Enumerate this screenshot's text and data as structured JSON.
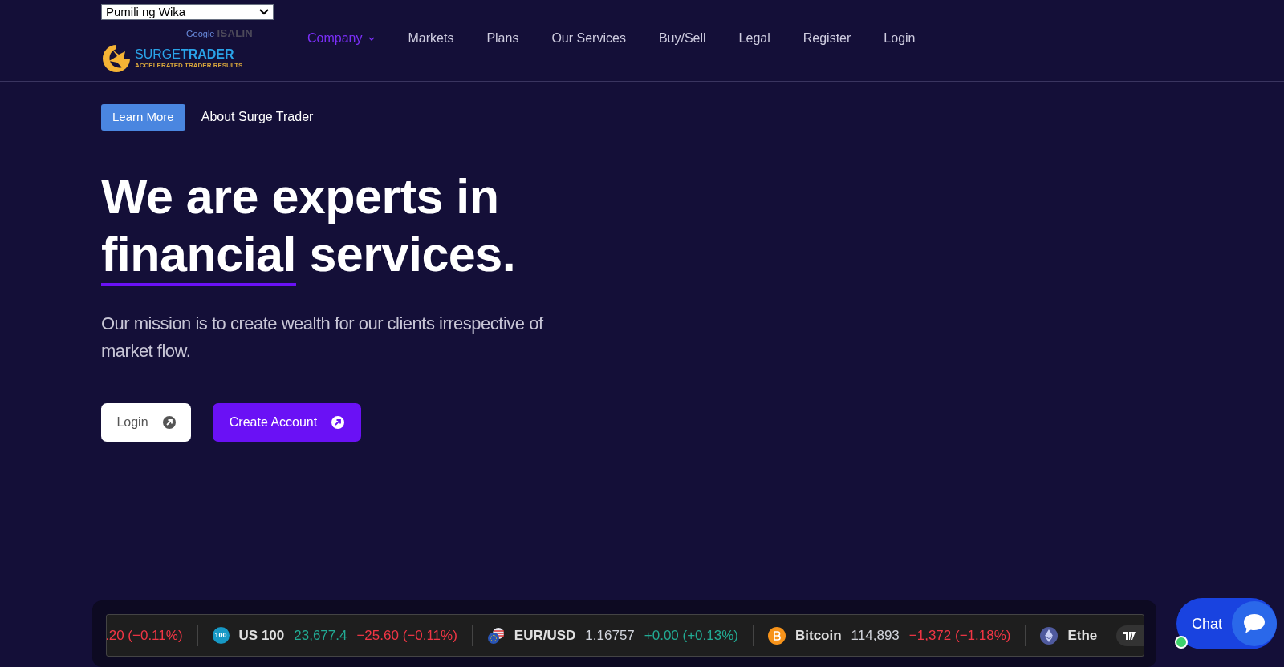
{
  "language_select": {
    "value": "Pumili ng Wika"
  },
  "translate_credit": {
    "brand": "Google",
    "action": "ISALIN"
  },
  "logo": {
    "name_part1": "SURGE",
    "name_part2": "TRADER",
    "tagline": "ACCELERATED TRADER RESULTS"
  },
  "nav": [
    {
      "label": "Company",
      "selected": true,
      "has_menu": true
    },
    {
      "label": "Markets",
      "selected": false,
      "has_menu": false
    },
    {
      "label": "Plans",
      "selected": false,
      "has_menu": false
    },
    {
      "label": "Our Services",
      "selected": false,
      "has_menu": false
    },
    {
      "label": "Buy/Sell",
      "selected": false,
      "has_menu": false
    },
    {
      "label": "Legal",
      "selected": false,
      "has_menu": false
    },
    {
      "label": "Register",
      "selected": false,
      "has_menu": false
    },
    {
      "label": "Login",
      "selected": false,
      "has_menu": false
    }
  ],
  "hero": {
    "badge": "Learn More",
    "badge_caption": "About Surge Trader",
    "title": "We are experts in",
    "title_highlight": "financial",
    "title_end": "services.",
    "subtitle": "Our mission is to create wealth for our clients irrespective of market flow.",
    "buttons": [
      {
        "label": "Login",
        "kind": "secondary"
      },
      {
        "label": "Create Account",
        "kind": "primary"
      }
    ]
  },
  "ticker": [
    {
      "kind": "plain",
      "change": ".20 (−0.11%)",
      "change_positive": false
    },
    {
      "kind": "badge",
      "icon_text": "100",
      "name": "US 100",
      "price": "23,677.4",
      "price_up": true,
      "change": "−25.60 (−0.11%)",
      "change_positive": false
    },
    {
      "kind": "flag",
      "name": "EUR/USD",
      "price": "1.16757",
      "price_up": false,
      "change": "+0.00 (+0.13%)",
      "change_positive": true
    },
    {
      "kind": "bitcoin",
      "name": "Bitcoin",
      "price": "114,893",
      "price_up": false,
      "change": "−1,372 (−1.18%)",
      "change_positive": false
    },
    {
      "kind": "ethereum",
      "name": "Ethe"
    }
  ],
  "chat": {
    "label": "Chat",
    "online": true
  }
}
